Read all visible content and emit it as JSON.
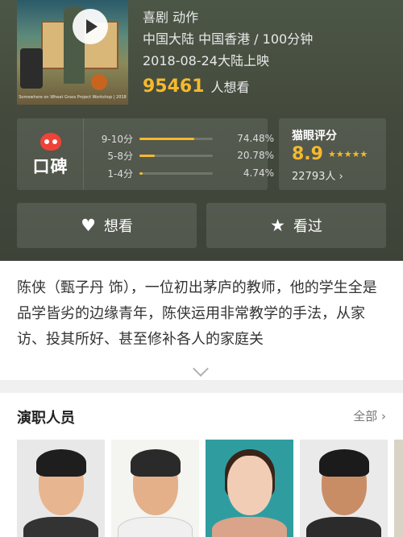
{
  "movie": {
    "genre": "喜剧 动作",
    "country_duration": "中国大陆 中国香港 / 100分钟",
    "release": "2018-08-24大陆上映",
    "want_count": "95461",
    "want_label": "人想看",
    "poster_caption": "Somewhere on Wheat Grass Project Workshop | 2018"
  },
  "koubei": {
    "label": "口碑",
    "distribution": [
      {
        "label": "9-10分",
        "percent_text": "74.48%",
        "fraction": 0.7448
      },
      {
        "label": "5-8分",
        "percent_text": "20.78%",
        "fraction": 0.2078
      },
      {
        "label": "1-4分",
        "percent_text": "4.74%",
        "fraction": 0.0474
      }
    ]
  },
  "maoyan": {
    "title": "猫眼评分",
    "score": "8.9",
    "stars": "★★★★★",
    "votes": "22793人 ›"
  },
  "actions": {
    "want": {
      "label": "想看",
      "icon": "heart-icon",
      "glyph": "♥"
    },
    "seen": {
      "label": "看过",
      "icon": "star-icon",
      "glyph": "★"
    }
  },
  "synopsis": {
    "text": "陈侠（甄子丹 饰），一位初出茅庐的教师，他的学生全是品学皆劣的边缘青年，陈侠运用非常教学的手法，从家访、投其所好、甚至修补各人的家庭关"
  },
  "cast": {
    "title": "演职人员",
    "all_label": "全部 ›"
  },
  "colors": {
    "accent": "#f5b92e",
    "brand_red": "#ef4238"
  }
}
